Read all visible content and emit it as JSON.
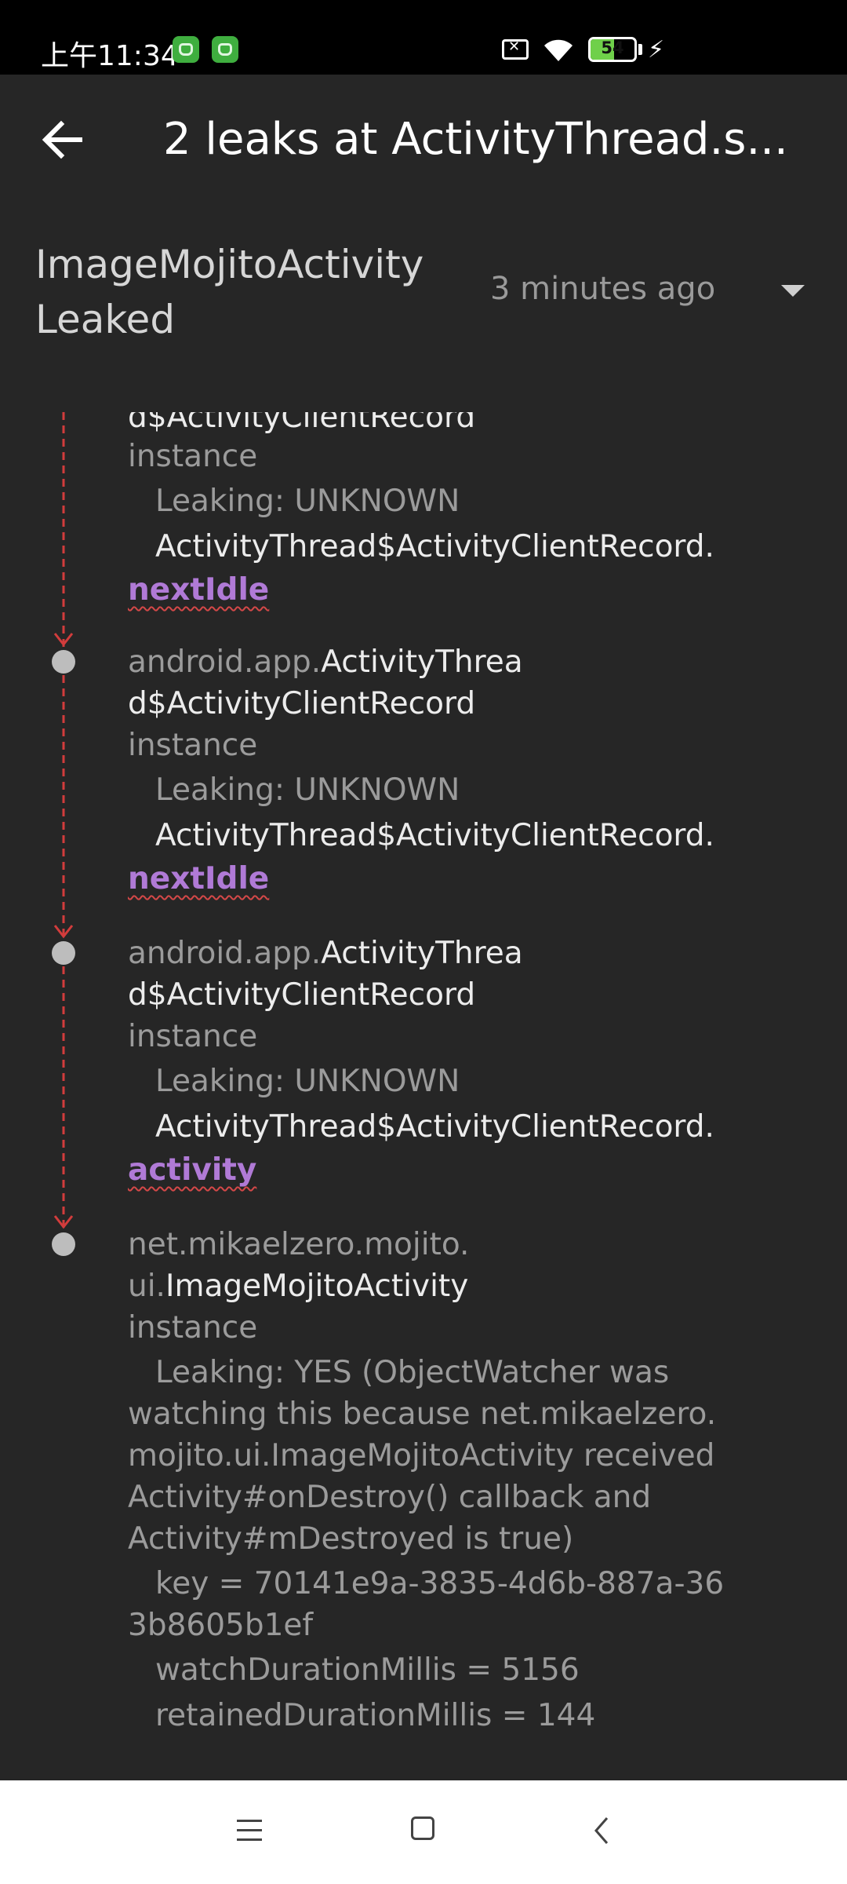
{
  "status_bar": {
    "time": "上午11:34",
    "battery_level": "54",
    "battery_fraction": 0.54,
    "icons": [
      "notification-app-icon",
      "notification-app-icon",
      "sim-no-service-icon",
      "wifi-icon",
      "battery-icon",
      "charging-bolt-icon"
    ]
  },
  "app_bar": {
    "title": "2 leaks at ActivityThread.s...",
    "back_icon": "arrow-left-icon"
  },
  "header": {
    "title_line1": "ImageMojitoActivity",
    "title_line2": "Leaked",
    "time_ago": "3 minutes ago",
    "dropdown_icon": "triangle-down-icon"
  },
  "trace": {
    "partial_top": {
      "class_cut": "d$ActivityClientRecord",
      "instance": "instance",
      "leaking": "Leaking: UNKNOWN",
      "ref_prefix": "ActivityThread$ActivityClientRecord.",
      "ref_field": "nextIdle"
    },
    "nodes": [
      {
        "package": "android.app.",
        "class_part1": "ActivityThrea",
        "class_part2": "d$ActivityClientRecord",
        "instance": "instance",
        "leaking": "Leaking: UNKNOWN",
        "ref_prefix": "ActivityThread$ActivityClientRecord.",
        "ref_field": "nextIdle"
      },
      {
        "package": "android.app.",
        "class_part1": "ActivityThrea",
        "class_part2": "d$ActivityClientRecord",
        "instance": "instance",
        "leaking": "Leaking: UNKNOWN",
        "ref_prefix": "ActivityThread$ActivityClientRecord.",
        "ref_field": "activity"
      }
    ],
    "leaking_node": {
      "package_line1": "net.mikaelzero.mojito.",
      "package_line2": "ui.",
      "class_name": "ImageMojitoActivity",
      "instance": "instance",
      "leaking_lines": [
        "Leaking: YES (ObjectWatcher was",
        "watching this because net.mikaelzero.",
        "mojito.ui.ImageMojitoActivity received",
        "Activity#onDestroy() callback and",
        "Activity#mDestroyed is true)"
      ],
      "key_line1": "key = 70141e9a-3835-4d6b-887a-36",
      "key_line2": "3b8605b1ef",
      "watch_duration": "watchDurationMillis = 5156",
      "retained_duration": "retainedDurationMillis = 144"
    }
  },
  "nav_bar": {
    "icons": [
      "menu-icon",
      "home-square-icon",
      "back-chevron-icon"
    ]
  },
  "colors": {
    "background": "#262626",
    "status_bar": "#000000",
    "trace_line": "#d23c3c",
    "reference_field": "#b07ad6",
    "node_dot": "#bdbdbd",
    "battery_fill": "#6fd04a"
  }
}
